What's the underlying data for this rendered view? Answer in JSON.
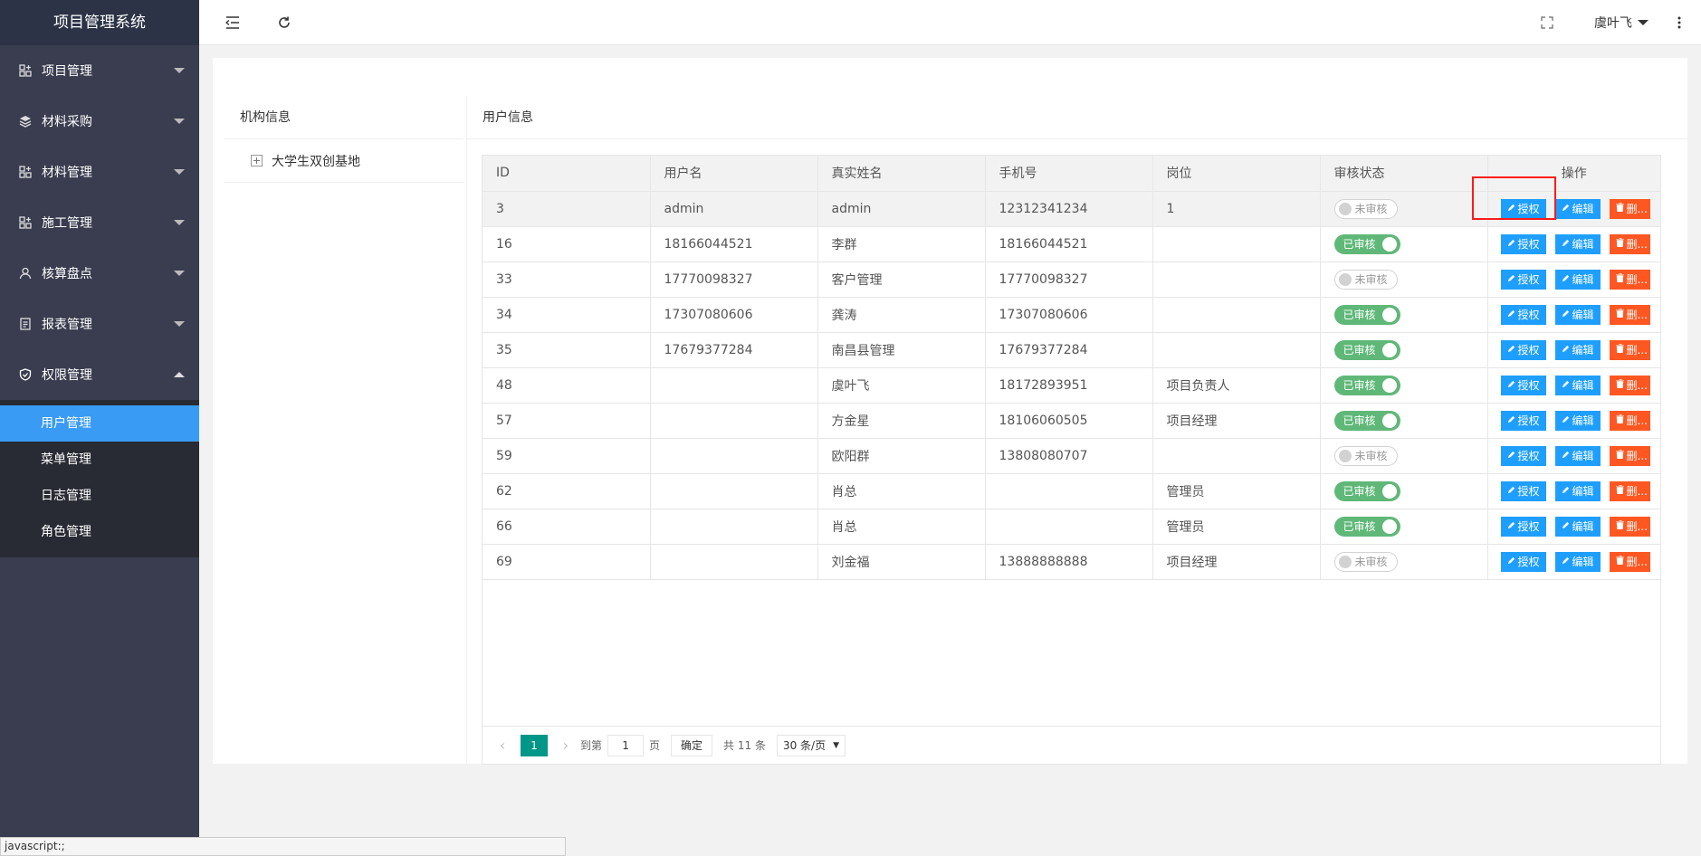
{
  "app_title": "项目管理系统",
  "sidebar": {
    "items": [
      {
        "label": "项目管理",
        "icon": "grid-plus-icon"
      },
      {
        "label": "材料采购",
        "icon": "layers-icon"
      },
      {
        "label": "材料管理",
        "icon": "grid-plus-icon"
      },
      {
        "label": "施工管理",
        "icon": "grid-plus-icon"
      },
      {
        "label": "核算盘点",
        "icon": "user-icon"
      },
      {
        "label": "报表管理",
        "icon": "list-icon"
      },
      {
        "label": "权限管理",
        "icon": "shield-icon"
      }
    ],
    "submenu": [
      {
        "label": "用户管理"
      },
      {
        "label": "菜单管理"
      },
      {
        "label": "日志管理"
      },
      {
        "label": "角色管理"
      }
    ]
  },
  "header": {
    "user_name": "虞叶飞"
  },
  "left_panel": {
    "title": "机构信息",
    "tree_root": "大学生双创基地"
  },
  "right_panel": {
    "title": "用户信息"
  },
  "table": {
    "columns": [
      "ID",
      "用户名",
      "真实姓名",
      "手机号",
      "岗位",
      "审核状态",
      "操作"
    ],
    "rows": [
      {
        "id": "3",
        "username": "admin",
        "realname": "admin",
        "phone": "12312341234",
        "post": "1",
        "status": "未审核",
        "approved": false
      },
      {
        "id": "16",
        "username": "18166044521",
        "realname": "李群",
        "phone": "18166044521",
        "post": "",
        "status": "已审核",
        "approved": true
      },
      {
        "id": "33",
        "username": "17770098327",
        "realname": "客户管理",
        "phone": "17770098327",
        "post": "",
        "status": "未审核",
        "approved": false
      },
      {
        "id": "34",
        "username": "17307080606",
        "realname": "龚涛",
        "phone": "17307080606",
        "post": "",
        "status": "已审核",
        "approved": true
      },
      {
        "id": "35",
        "username": "17679377284",
        "realname": "南昌县管理",
        "phone": "17679377284",
        "post": "",
        "status": "已审核",
        "approved": true
      },
      {
        "id": "48",
        "username": "",
        "realname": "虞叶飞",
        "phone": "18172893951",
        "post": "项目负责人",
        "status": "已审核",
        "approved": true
      },
      {
        "id": "57",
        "username": "",
        "realname": "方金星",
        "phone": "18106060505",
        "post": "项目经理",
        "status": "已审核",
        "approved": true
      },
      {
        "id": "59",
        "username": "",
        "realname": "欧阳群",
        "phone": "13808080707",
        "post": "",
        "status": "未审核",
        "approved": false
      },
      {
        "id": "62",
        "username": "",
        "realname": "肖总",
        "phone": "",
        "post": "管理员",
        "status": "已审核",
        "approved": true
      },
      {
        "id": "66",
        "username": "",
        "realname": "肖总",
        "phone": "",
        "post": "管理员",
        "status": "已审核",
        "approved": true
      },
      {
        "id": "69",
        "username": "",
        "realname": "刘金福",
        "phone": "13888888888",
        "post": "项目经理",
        "status": "未审核",
        "approved": false
      }
    ],
    "actions": {
      "authorize": "授权",
      "edit": "编辑",
      "delete": "删..."
    }
  },
  "pager": {
    "current_page": "1",
    "goto_label": "到第",
    "page_input_value": "1",
    "page_unit": "页",
    "confirm_label": "确定",
    "total_text": "共 11 条",
    "page_size": "30 条/页"
  },
  "statusbar_text": "javascript:;"
}
